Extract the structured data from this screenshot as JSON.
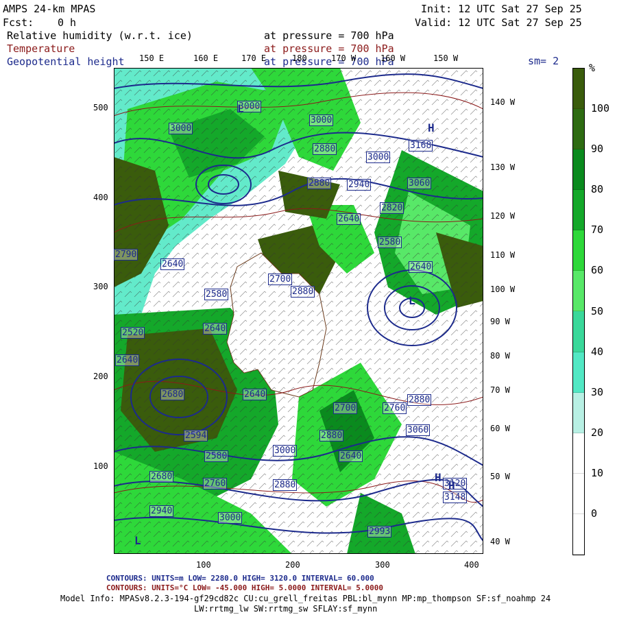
{
  "header": {
    "model_title": "AMPS 24-km MPAS",
    "forecast_label": "Fcst:",
    "forecast_value": "0 h",
    "init": "Init: 12 UTC Sat 27 Sep 25",
    "valid": "Valid: 12 UTC Sat 27 Sep 25",
    "field_rh": "Relative humidity (w.r.t. ice)",
    "field_temp": "Temperature",
    "field_geo": "Geopotential height",
    "pressure_rh": "at pressure =  700 hPa",
    "pressure_temp": "at pressure =  700 hPa",
    "pressure_geo": "at pressure =  700 hPa",
    "smoothing": "sm= 2",
    "colors": {
      "rh": "#000000",
      "temp": "#8b1a1a",
      "geo": "#1c2a8c"
    }
  },
  "map": {
    "top_longitudes": [
      "150 E",
      "160 E",
      "170 E",
      "180",
      "170 W",
      "160 W",
      "150 W"
    ],
    "right_longitudes": [
      "140 W",
      "130 W",
      "120 W",
      "110 W",
      "100 W",
      "90 W",
      "80 W",
      "70 W",
      "60 W",
      "50 W",
      "40 W"
    ],
    "y_ticks": [
      "500",
      "400",
      "300",
      "200",
      "100"
    ],
    "x_ticks": [
      "100",
      "200",
      "300",
      "400"
    ],
    "height_labels": [
      "3000",
      "3000",
      "3000",
      "2880",
      "3000",
      "2880",
      "3060",
      "3168",
      "2940",
      "2820",
      "2640",
      "2580",
      "2640",
      "2790",
      "2640",
      "2580",
      "2640",
      "2700",
      "2880",
      "2520",
      "2640",
      "2680",
      "2594",
      "2640",
      "2700",
      "2880",
      "2760",
      "3060",
      "2880",
      "3000",
      "2580",
      "2640",
      "2760",
      "2680",
      "2880",
      "2940",
      "3000",
      "2993",
      "3148",
      "3120"
    ],
    "pressure_centers": [
      "H",
      "H",
      "L",
      "L",
      "H",
      "L"
    ],
    "continent_fill": "#ffffff",
    "coast_color": "#6b3a1a"
  },
  "colorbar": {
    "unit": "%",
    "labels": [
      "100",
      "90",
      "80",
      "70",
      "60",
      "50",
      "40",
      "30",
      "20",
      "10",
      "0"
    ],
    "colors": [
      "#3a5c0c",
      "#2e6b12",
      "#0a8a1e",
      "#14a82a",
      "#2ed83a",
      "#58e868",
      "#3ad89a",
      "#52e8c4",
      "#b8f0e4",
      "#ffffff",
      "#ffffff",
      "#ffffff"
    ]
  },
  "footer": {
    "contour_blue": "CONTOURS:  UNITS=m  LOW=  2280.0      HIGH=  3120.0       INTERVAL=  60.000",
    "contour_red": "CONTOURS:  UNITS=°C  LOW=  -45.000     HIGH=  5.0000       INTERVAL=  5.0000",
    "model_info": "Model Info: MPASv8.2.3-194-gf29cd82c CU:cu_grell_freitas PBL:bl_mynn MP:mp_thompson SF:sf_noahmp 24",
    "model_info2": "LW:rrtmg_lw SW:rrtmg_sw SFLAY:sf_mynn"
  }
}
